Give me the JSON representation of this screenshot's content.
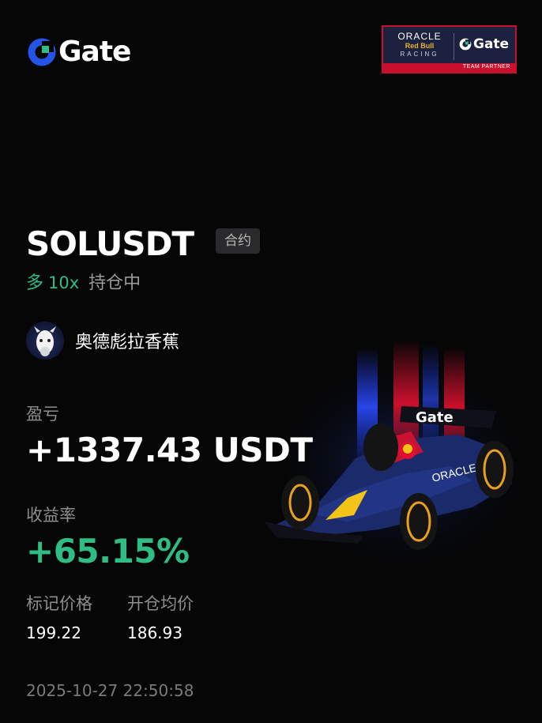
{
  "brand": {
    "name": "Gate",
    "accent": "#2354e6",
    "green": "#2ebd85"
  },
  "partner": {
    "oracle": "ORACLE",
    "redbull": "Red Bull",
    "racing": "RACING",
    "gate": "Gate",
    "tag": "TEAM PARTNER"
  },
  "position": {
    "pair": "SOLUSDT",
    "type_badge": "合约",
    "direction": "多",
    "leverage": "10x",
    "status": "持仓中"
  },
  "user": {
    "name": "奥德彪拉香蕉"
  },
  "pnl": {
    "label": "盈亏",
    "value": "+1337.43 USDT"
  },
  "roi": {
    "label": "收益率",
    "value": "+65.15%"
  },
  "prices": {
    "mark_label": "标记价格",
    "mark_value": "199.22",
    "entry_label": "开仓均价",
    "entry_value": "186.93"
  },
  "timestamp": "2025-10-27 22:50:58",
  "car_livery": {
    "gate": "Gate",
    "oracle": "ORACLE"
  }
}
